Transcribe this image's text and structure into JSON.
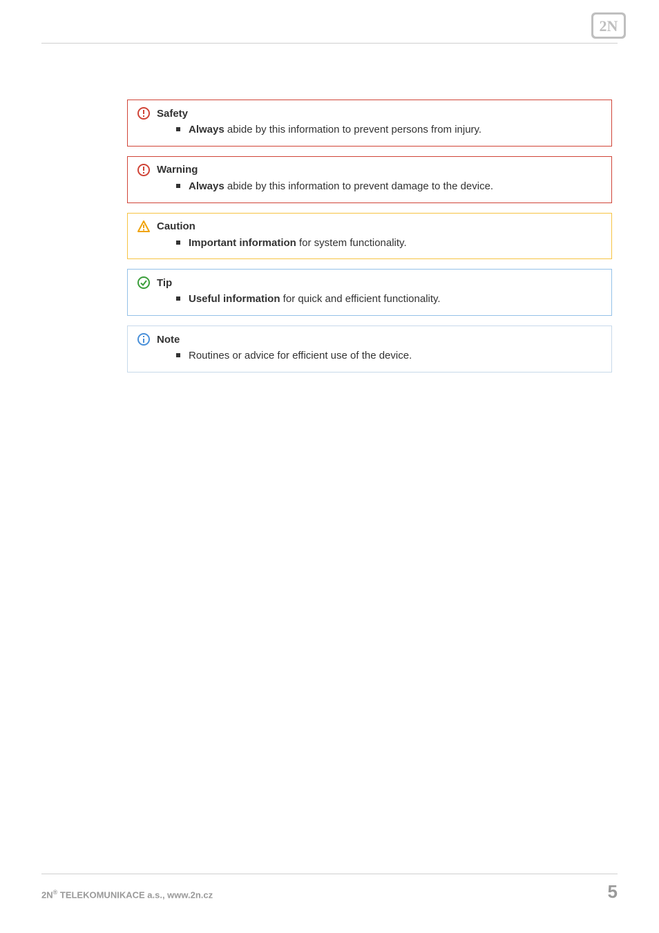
{
  "logo": {
    "text": "2N"
  },
  "panels": {
    "safety": {
      "title": "Safety",
      "bullet_bold": "Always",
      "bullet_rest": "  abide by this information to prevent persons from injury."
    },
    "warning": {
      "title": "Warning",
      "bullet_bold": "Always",
      "bullet_rest": " abide by this information to prevent damage to the device."
    },
    "caution": {
      "title": "Caution",
      "bullet_bold": "Important information",
      "bullet_rest": " for system functionality."
    },
    "tip": {
      "title": "Tip",
      "bullet_bold": "Useful information",
      "bullet_rest": " for quick and efficient functionality."
    },
    "note": {
      "title": "Note",
      "bullet_bold": "",
      "bullet_rest": "Routines or advice for efficient use of the device."
    }
  },
  "footer": {
    "company_prefix": "2N",
    "company_sup": "®",
    "company_rest": " TELEKOMUNIKACE a.s., www.2n.cz",
    "page_number": "5"
  }
}
